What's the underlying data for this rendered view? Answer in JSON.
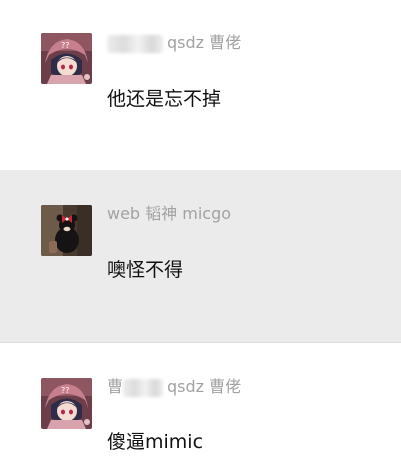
{
  "messages": [
    {
      "sender_visible": "qsdz 曹佬",
      "text": "他还是忘不掉",
      "avatar_icon": "anime-girl-avatar-icon",
      "highlighted": false
    },
    {
      "sender_visible": "web 韬神 micgo",
      "text": "噢怪不得",
      "avatar_icon": "plush-toy-avatar-icon",
      "highlighted": true
    },
    {
      "sender_prefix": "曹",
      "sender_visible": "qsdz 曹佬",
      "text": "傻逼mimic",
      "avatar_icon": "anime-girl-avatar-icon",
      "highlighted": false
    }
  ],
  "colors": {
    "highlight_bg": "#ebebeb",
    "sender_text": "#a2a2a2",
    "message_text": "#111111"
  }
}
